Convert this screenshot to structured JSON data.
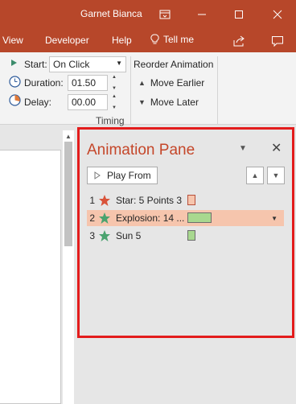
{
  "window": {
    "user_name": "Garnet Bianca"
  },
  "tabs": {
    "view": "View",
    "developer": "Developer",
    "help": "Help",
    "tell_me": "Tell me"
  },
  "timing": {
    "start_label": "Start:",
    "start_value": "On Click",
    "duration_label": "Duration:",
    "duration_value": "01.50",
    "delay_label": "Delay:",
    "delay_value": "00.00",
    "reorder_label": "Reorder Animation",
    "move_earlier": "Move Earlier",
    "move_later": "Move Later",
    "group_label": "Timing"
  },
  "pane": {
    "title": "Animation Pane",
    "play_from": "Play From",
    "items": [
      {
        "num": "1",
        "name": "Star: 5 Points 3",
        "star_color": "#d9533a",
        "bar_color": "#f6c5ad"
      },
      {
        "num": "2",
        "name": "Explosion: 14 ...",
        "star_color": "#4aa36f",
        "bar_color": "#a8d88f"
      },
      {
        "num": "3",
        "name": "Sun 5",
        "star_color": "#4aa36f",
        "bar_color": "#a8d88f"
      }
    ]
  },
  "colors": {
    "brand": "#b7472a",
    "highlight_border": "#e31c1c",
    "selected_row": "#f6c5ad"
  }
}
